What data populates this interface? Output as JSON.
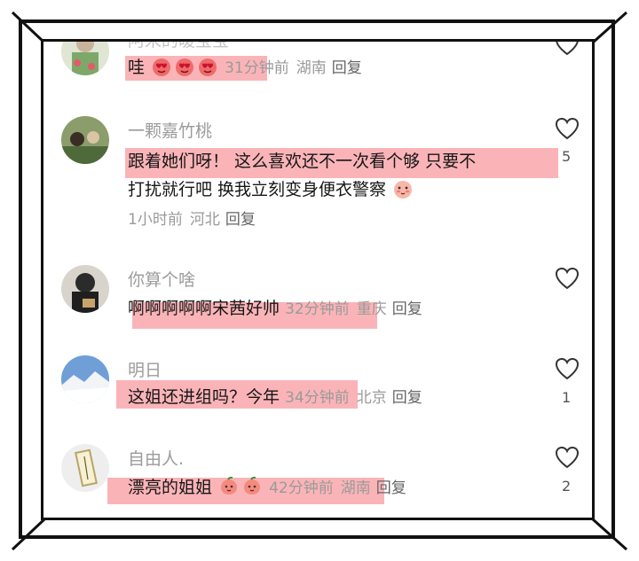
{
  "comments": [
    {
      "username": "阿宋的暖宝宝",
      "text": "哇",
      "emojis": [
        "heart-eyes-emoji",
        "heart-eyes-emoji",
        "heart-eyes-emoji"
      ],
      "time": "31分钟前",
      "region": "湖南",
      "reply": "回复",
      "likes": ""
    },
    {
      "username": "一颗嘉竹桃",
      "text_line1": "跟着她们呀！ 这么喜欢还不一次看个够 只要不",
      "text_line2": "打扰就行吧 换我立刻变身便衣警察",
      "emojis": [
        "shy-peach-emoji"
      ],
      "time": "1小时前",
      "region": "河北",
      "reply": "回复",
      "likes": "5"
    },
    {
      "username": "你算个啥",
      "text": "啊啊啊啊啊宋茜好帅",
      "time": "32分钟前",
      "region": "重庆",
      "reply": "回复",
      "likes": ""
    },
    {
      "username": "明日",
      "text": "这姐还进组吗？今年",
      "time": "34分钟前",
      "region": "北京",
      "reply": "回复",
      "likes": "1"
    },
    {
      "username": "自由人.",
      "text": "漂亮的姐姐",
      "emojis": [
        "peach-emoji",
        "peach-emoji"
      ],
      "time": "42分钟前",
      "region": "湖南",
      "reply": "回复",
      "likes": "2"
    }
  ],
  "colors": {
    "highlight": "#f79196",
    "text": "#161616",
    "meta": "#9a9a9a",
    "username": "#9b9b9b"
  }
}
